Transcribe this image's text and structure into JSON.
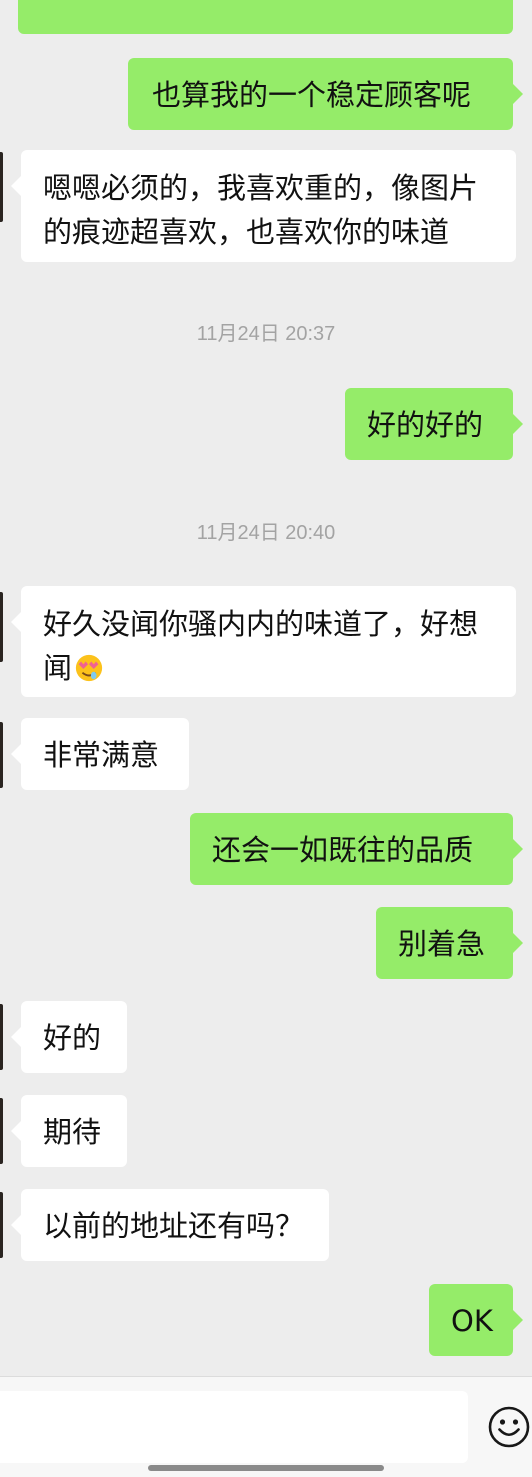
{
  "colors": {
    "background": "#ededed",
    "outgoing_bubble": "#95ec69",
    "incoming_bubble": "#ffffff",
    "timestamp": "#a3a3a3"
  },
  "messages": [
    {
      "side": "out",
      "text": "也算我的一个稳定顾客呢"
    },
    {
      "side": "in",
      "text": "嗯嗯必须的，我喜欢重的，像图片的痕迹超喜欢，也喜欢你的味道"
    },
    {
      "time": "11月24日 20:37"
    },
    {
      "side": "out",
      "text": "好的好的"
    },
    {
      "time": "11月24日 20:40"
    },
    {
      "side": "in",
      "text": "好久没闻你骚内内的味道了，好想闻",
      "emoji": "star-struck-emoji"
    },
    {
      "side": "in",
      "text": "非常满意"
    },
    {
      "side": "out",
      "text": "还会一如既往的品质"
    },
    {
      "side": "out",
      "text": "别着急"
    },
    {
      "side": "in",
      "text": "好的"
    },
    {
      "side": "in",
      "text": "期待"
    },
    {
      "side": "in",
      "text": "以前的地址还有吗？"
    },
    {
      "side": "out",
      "text": "OK"
    }
  ],
  "input_bar": {
    "value": "",
    "emoji_button_icon": "smiley-face-icon"
  }
}
